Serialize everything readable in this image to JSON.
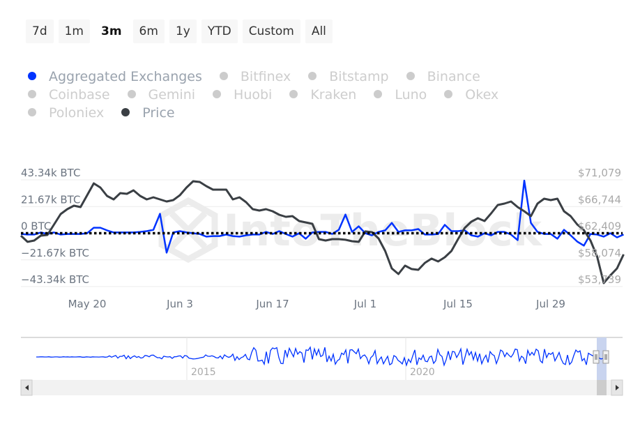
{
  "range_selector": {
    "buttons": [
      "7d",
      "1m",
      "3m",
      "6m",
      "1y",
      "YTD",
      "Custom",
      "All"
    ],
    "active": "3m"
  },
  "legend": [
    {
      "label": "Aggregated Exchanges",
      "color": "#0033ff",
      "visible": true
    },
    {
      "label": "Bitfinex",
      "color": "#cccccc",
      "visible": false
    },
    {
      "label": "Bitstamp",
      "color": "#cccccc",
      "visible": false
    },
    {
      "label": "Binance",
      "color": "#cccccc",
      "visible": false
    },
    {
      "label": "Coinbase",
      "color": "#cccccc",
      "visible": false
    },
    {
      "label": "Gemini",
      "color": "#cccccc",
      "visible": false
    },
    {
      "label": "Huobi",
      "color": "#cccccc",
      "visible": false
    },
    {
      "label": "Kraken",
      "color": "#cccccc",
      "visible": false
    },
    {
      "label": "Luno",
      "color": "#cccccc",
      "visible": false
    },
    {
      "label": "Okex",
      "color": "#cccccc",
      "visible": false
    },
    {
      "label": "Poloniex",
      "color": "#cccccc",
      "visible": false
    },
    {
      "label": "Price",
      "color": "#3a3f44",
      "visible": true
    }
  ],
  "watermark": "IntoTheBlock",
  "chart_data": {
    "type": "line",
    "title": "",
    "grid": true,
    "zero_line": "dotted",
    "x": [
      "May 10",
      "May 11",
      "May 12",
      "May 13",
      "May 14",
      "May 15",
      "May 16",
      "May 17",
      "May 18",
      "May 19",
      "May 20",
      "May 21",
      "May 22",
      "May 23",
      "May 24",
      "May 25",
      "May 26",
      "May 27",
      "May 28",
      "May 29",
      "May 30",
      "May 31",
      "Jun 1",
      "Jun 2",
      "Jun 3",
      "Jun 4",
      "Jun 5",
      "Jun 6",
      "Jun 7",
      "Jun 8",
      "Jun 9",
      "Jun 10",
      "Jun 11",
      "Jun 12",
      "Jun 13",
      "Jun 14",
      "Jun 15",
      "Jun 16",
      "Jun 17",
      "Jun 18",
      "Jun 19",
      "Jun 20",
      "Jun 21",
      "Jun 22",
      "Jun 23",
      "Jun 24",
      "Jun 25",
      "Jun 26",
      "Jun 27",
      "Jun 28",
      "Jun 29",
      "Jun 30",
      "Jul 1",
      "Jul 2",
      "Jul 3",
      "Jul 4",
      "Jul 5",
      "Jul 6",
      "Jul 7",
      "Jul 8",
      "Jul 9",
      "Jul 10",
      "Jul 11",
      "Jul 12",
      "Jul 13",
      "Jul 14",
      "Jul 15",
      "Jul 16",
      "Jul 17",
      "Jul 18",
      "Jul 19",
      "Jul 20",
      "Jul 21",
      "Jul 22",
      "Jul 23",
      "Jul 24",
      "Jul 25",
      "Jul 26",
      "Jul 27",
      "Jul 28",
      "Jul 29",
      "Jul 30",
      "Jul 31",
      "Aug 1",
      "Aug 2",
      "Aug 3",
      "Aug 4",
      "Aug 5",
      "Aug 6",
      "Aug 7",
      "Aug 8",
      "Aug 9"
    ],
    "x_ticks": [
      "May 20",
      "Jun 3",
      "Jun 17",
      "Jul 1",
      "Jul 15",
      "Jul 29"
    ],
    "y_left": {
      "ticks": [
        "43.34k BTC",
        "21.67k BTC",
        "0 BTC",
        "−21.67k BTC",
        "−43.34k BTC"
      ],
      "range": [
        -43340,
        43340
      ]
    },
    "y_right": {
      "ticks": [
        "$71,079",
        "$66,744",
        "$62,409",
        "$58,074",
        "$53,739"
      ],
      "range": [
        53739,
        71079
      ]
    },
    "series": [
      {
        "name": "Aggregated Exchanges",
        "axis": "left",
        "color": "#0033ff",
        "values": [
          -600,
          -1100,
          -1100,
          600,
          -600,
          600,
          -1100,
          -600,
          -600,
          -600,
          0,
          4500,
          4500,
          2300,
          600,
          600,
          600,
          600,
          1100,
          1700,
          2800,
          15800,
          -15800,
          600,
          1700,
          600,
          0,
          -600,
          -2800,
          -2300,
          -2300,
          -1100,
          -2300,
          -2800,
          -1700,
          -1100,
          -1100,
          1100,
          -600,
          1700,
          -600,
          -2800,
          0,
          -4500,
          600,
          1100,
          1100,
          -600,
          2800,
          15200,
          1100,
          5600,
          0,
          -1700,
          1100,
          2300,
          8400,
          1100,
          2300,
          2300,
          3400,
          -1100,
          -1100,
          -600,
          6800,
          1700,
          1700,
          2300,
          -1700,
          -2800,
          0,
          -1700,
          1100,
          1100,
          -1100,
          -5600,
          42800,
          8400,
          1100,
          -600,
          -600,
          -4500,
          2800,
          -1700,
          -6800,
          -10100,
          -600,
          -1100,
          -2800,
          0,
          -3400,
          -1100
        ]
      },
      {
        "name": "Price",
        "axis": "right",
        "color": "#3a3f44",
        "values": [
          62015,
          61000,
          61220,
          62015,
          62130,
          63830,
          65530,
          66320,
          66890,
          66660,
          68590,
          70510,
          69830,
          68470,
          67910,
          68930,
          68810,
          69380,
          68470,
          67910,
          68250,
          67910,
          67570,
          67790,
          68590,
          69830,
          70850,
          70740,
          70060,
          69490,
          69490,
          69490,
          67910,
          68250,
          67450,
          66320,
          66090,
          66320,
          65980,
          65410,
          65070,
          65190,
          64390,
          64170,
          63940,
          61450,
          61220,
          61450,
          61450,
          61340,
          61110,
          61000,
          62700,
          62580,
          61560,
          59520,
          56690,
          55780,
          57140,
          56580,
          56460,
          57590,
          58280,
          57820,
          58500,
          59520,
          61450,
          63260,
          64280,
          64850,
          64390,
          65640,
          67000,
          67230,
          67570,
          66660,
          65980,
          65190,
          67230,
          68020,
          67790,
          68020,
          65980,
          65190,
          63830,
          62920,
          61220,
          58620,
          54310,
          55560,
          56690,
          58960
        ]
      }
    ],
    "navigator": {
      "x_ticks": [
        "2015",
        "2020"
      ],
      "series_color": "#0033ff"
    }
  }
}
